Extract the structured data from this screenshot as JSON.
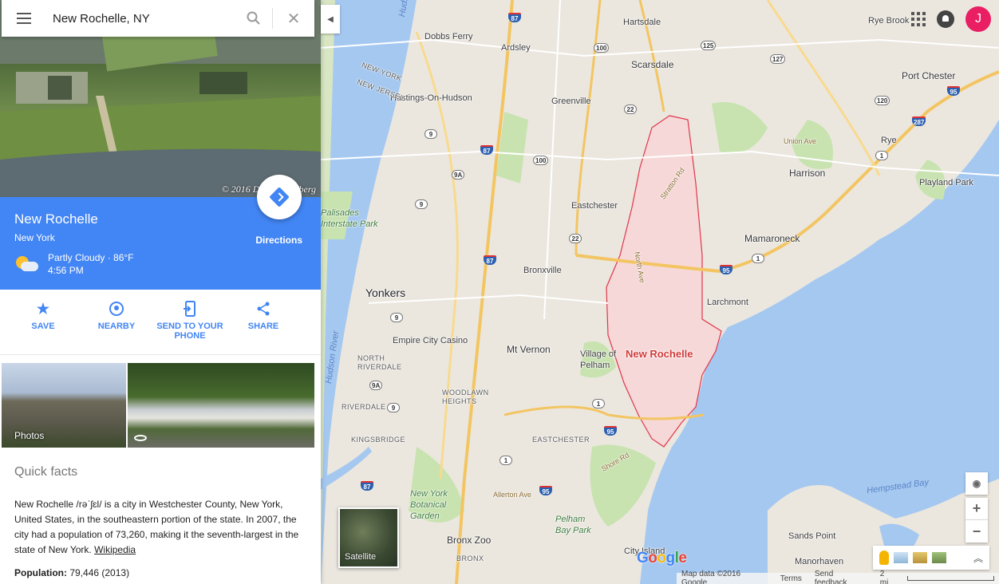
{
  "search": {
    "value": "New Rochelle, NY"
  },
  "place": {
    "title": "New Rochelle",
    "subtitle": "New York",
    "weather_line1": "Partly Cloudy · 86°F",
    "weather_line2": "4:56 PM",
    "directions_label": "Directions",
    "photo_credit": "© 2016 David Sternberg"
  },
  "actions": [
    {
      "label": "SAVE",
      "icon": "star-icon"
    },
    {
      "label": "NEARBY",
      "icon": "nearby-icon"
    },
    {
      "label": "SEND TO YOUR PHONE",
      "icon": "send-to-phone-icon"
    },
    {
      "label": "SHARE",
      "icon": "share-icon"
    }
  ],
  "photos": {
    "label": "Photos"
  },
  "facts": {
    "title": "Quick facts",
    "body": "New Rochelle /rəˈʃɛl/ is a city in Westchester County, New York, United States, in the southeastern portion of the state. In 2007, the city had a population of 73,260, making it the seventh-largest in the state of New York.",
    "link": "Wikipedia",
    "population_label": "Population:",
    "population_value": "79,446 (2013)"
  },
  "map": {
    "avatar_letter": "J",
    "satellite_label": "Satellite",
    "footer": {
      "data": "Map data ©2016 Google",
      "terms": "Terms",
      "feedback": "Send feedback",
      "scale": "2 mi"
    },
    "colors": {
      "water": "#a5c8f0",
      "land": "#e9e5dc",
      "park": "#c8e3b0",
      "highlight": "#f7d8d8",
      "boundary": "#e0364a"
    },
    "labels": {
      "hartsdale": "Hartsdale",
      "dobbs_ferry": "Dobbs Ferry",
      "ardsley": "Ardsley",
      "scarsdale": "Scarsdale",
      "rye_brook": "Rye Brook",
      "port_chester": "Port Chester",
      "hastings": "Hastings-On-Hudson",
      "greenville": "Greenville",
      "rye": "Rye",
      "harrison": "Harrison",
      "playland": "Playland Park",
      "eastchester": "Eastchester",
      "mamaroneck": "Mamaroneck",
      "palisades": "Palisades\nInterstate Park",
      "yonkers": "Yonkers",
      "bronxville": "Bronxville",
      "larchmont": "Larchmont",
      "empire_city": "Empire City Casino",
      "mt_vernon": "Mt Vernon",
      "village_pelham": "Village of\nPelham",
      "new_rochelle": "New Rochelle",
      "north_riverdale": "NORTH\nRIVERDALE",
      "woodlawn": "WOODLAWN\nHEIGHTS",
      "riverdale": "RIVERDALE",
      "kingsbridge": "KINGSBRIDGE",
      "eastchester_hood": "EASTCHESTER",
      "ny_botanical": "New York\nBotanical\nGarden",
      "pelham_bay": "Pelham\nBay Park",
      "bronx_zoo": "Bronx Zoo",
      "bronx": "BRONX",
      "city_island": "City Island",
      "sands_point": "Sands Point",
      "manorhaven": "Manorhaven",
      "hempstead_bay": "Hempstead Bay",
      "allerton": "Allerton Ave",
      "hudson_river": "Hudson River",
      "hudson_river2": "Hudson River",
      "new_york": "NEW YORK",
      "new_jersey": "NEW JERSEY",
      "shore_rd": "Shore Rd",
      "union_ave": "Union Ave",
      "stratton_rd": "Stratton Rd",
      "north_ave": "North Ave"
    }
  }
}
